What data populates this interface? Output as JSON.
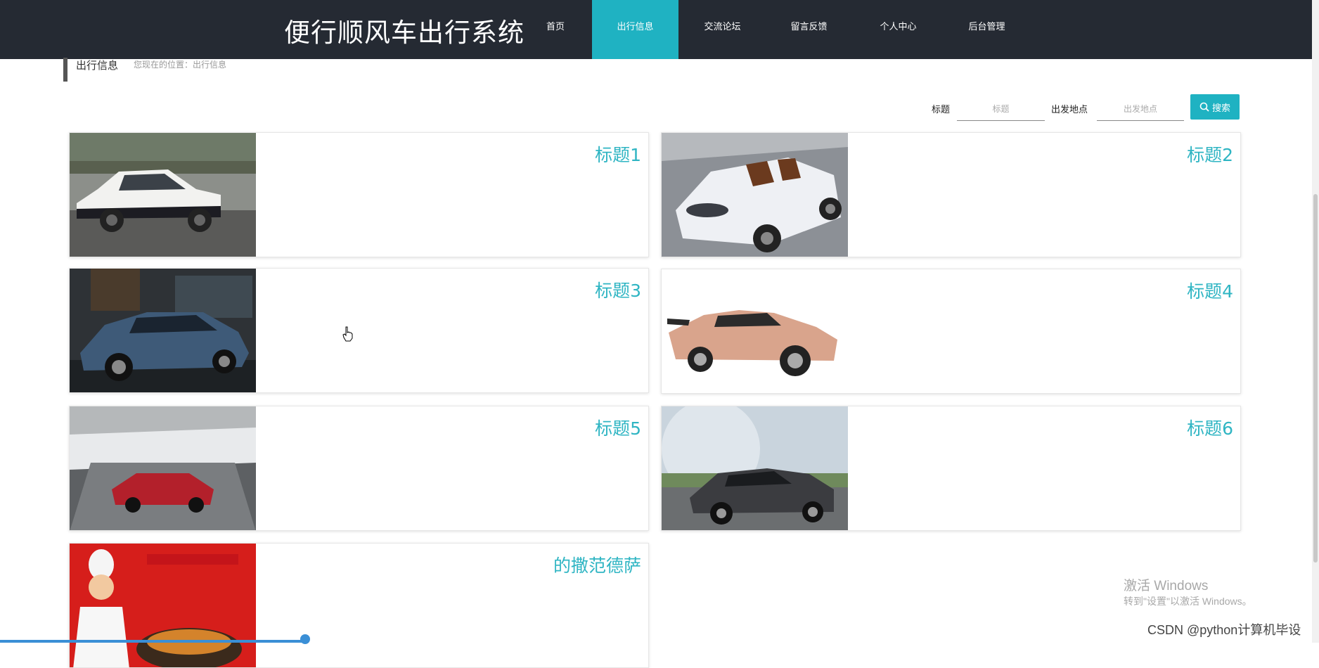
{
  "header": {
    "brand": "便行顺风车出行系统",
    "nav": [
      {
        "label": "首页",
        "active": false
      },
      {
        "label": "出行信息",
        "active": true
      },
      {
        "label": "交流论坛",
        "active": false
      },
      {
        "label": "留言反馈",
        "active": false
      },
      {
        "label": "个人中心",
        "active": false
      },
      {
        "label": "后台管理",
        "active": false
      }
    ]
  },
  "breadcrumb": {
    "title": "出行信息",
    "location": "您现在的位置：出行信息"
  },
  "search": {
    "title_label": "标题",
    "title_placeholder": "标题",
    "origin_label": "出发地点",
    "origin_placeholder": "出发地点",
    "button_label": "搜索"
  },
  "cards": [
    {
      "title": "标题1",
      "image": "white-black-hatchback-car-photo"
    },
    {
      "title": "标题2",
      "image": "white-roadster-car-photo"
    },
    {
      "title": "标题3",
      "image": "blue-sedan-car-photo"
    },
    {
      "title": "标题4",
      "image": "rose-gold-sports-car-photo"
    },
    {
      "title": "标题5",
      "image": "red-convertible-car-photo"
    },
    {
      "title": "标题6",
      "image": "dark-sedan-car-photo"
    },
    {
      "title": "的撒范德萨",
      "image": "chef-restaurant-poster"
    }
  ],
  "overlay": {
    "windows_line1": "激活 Windows",
    "windows_line2": "转到\"设置\"以激活 Windows。",
    "csdn": "CSDN @python计算机毕设"
  },
  "colors": {
    "accent": "#1fb2c2",
    "nav_bg": "#252a33",
    "title_color": "#2fb5c3"
  }
}
